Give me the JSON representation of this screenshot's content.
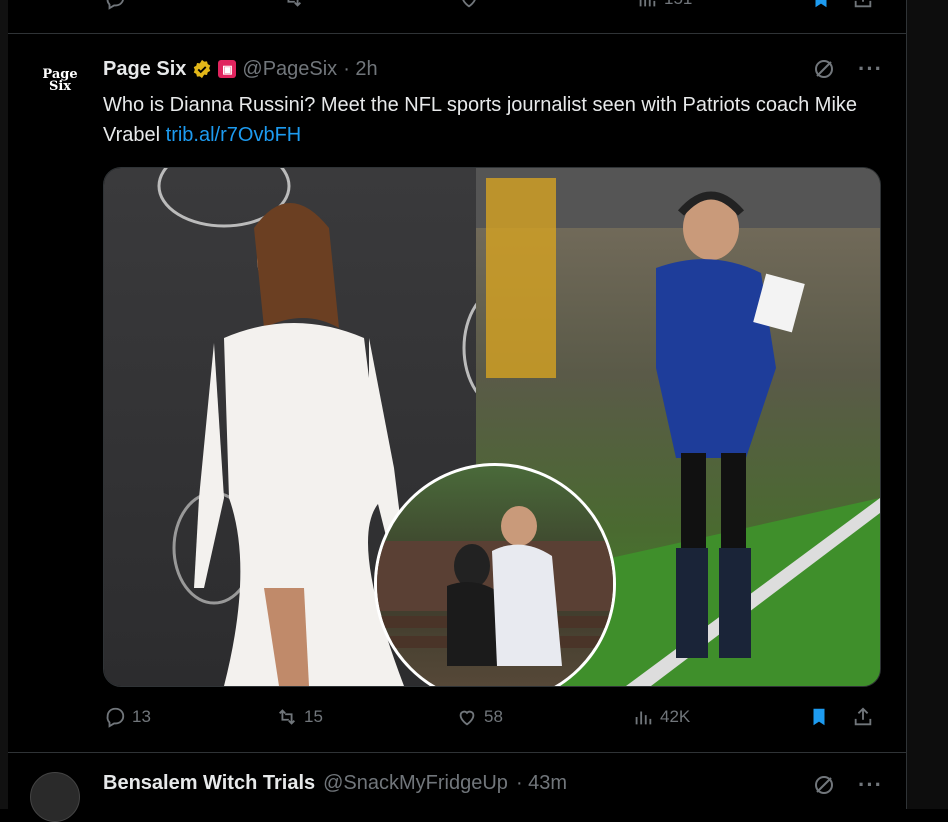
{
  "top_actions": {
    "views": "151"
  },
  "tweet": {
    "avatar_text_1": "Page",
    "avatar_text_2": "Six",
    "display_name": "Page Six",
    "handle": "@PageSix",
    "time": "· 2h",
    "text": "Who is Dianna Russini? Meet the NFL sports journalist seen with Patriots coach Mike Vrabel ",
    "link": "trib.al/r7OvbFH",
    "replies": "13",
    "reposts": "15",
    "likes": "58",
    "views": "42K"
  },
  "next_tweet": {
    "display_name": "Bensalem Witch Trials",
    "handle": "@SnackMyFridgeUp",
    "time": "· 43m"
  },
  "colors": {
    "link": "#1d9bf0",
    "muted": "#71767b",
    "bookmark_active": "#1d9bf0",
    "verified_gold": "#e2b719"
  }
}
